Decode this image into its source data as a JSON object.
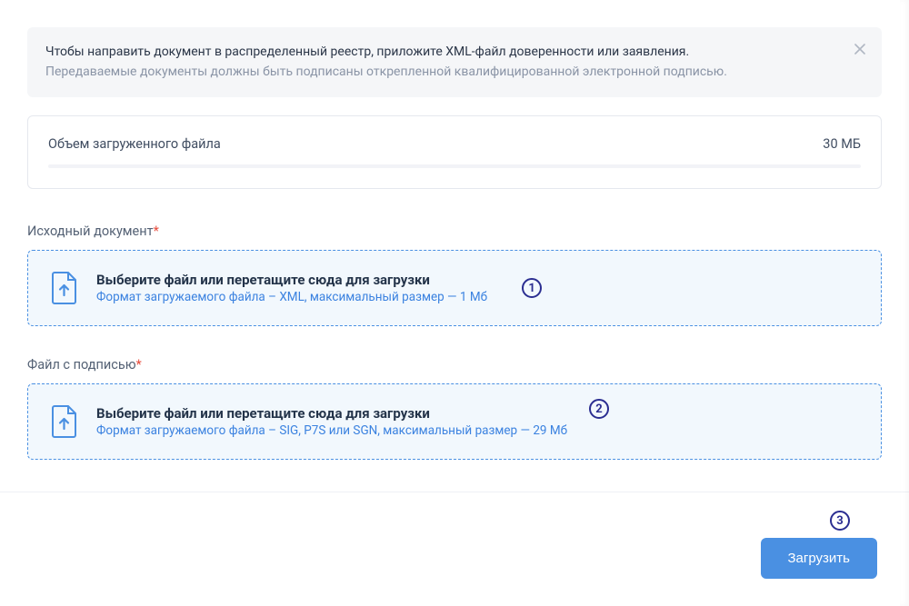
{
  "banner": {
    "title": "Чтобы направить документ в распределенный реестр, приложите XML-файл доверенности или заявления.",
    "subtitle": "Передаваемые документы должны быть подписаны открепленной квалифицированной электронной подписью."
  },
  "volume": {
    "label": "Объем загруженного файла",
    "value": "30 МБ"
  },
  "sourceDoc": {
    "label": "Исходный документ",
    "dropTitle": "Выберите файл или перетащите сюда для загрузки",
    "dropHint": "Формат загружаемого файла – XML, максимальный размер — 1 Мб"
  },
  "sigFile": {
    "label": "Файл с подписью",
    "dropTitle": "Выберите файл или перетащите сюда для загрузки",
    "dropHint": "Формат загружаемого файла – SIG, P7S или SGN, максимальный размер — 29 Мб"
  },
  "annotations": {
    "one": "1",
    "two": "2",
    "three": "3"
  },
  "actions": {
    "upload": "Загрузить"
  },
  "colors": {
    "accent": "#4a90e2",
    "badge": "#2b2e91"
  }
}
